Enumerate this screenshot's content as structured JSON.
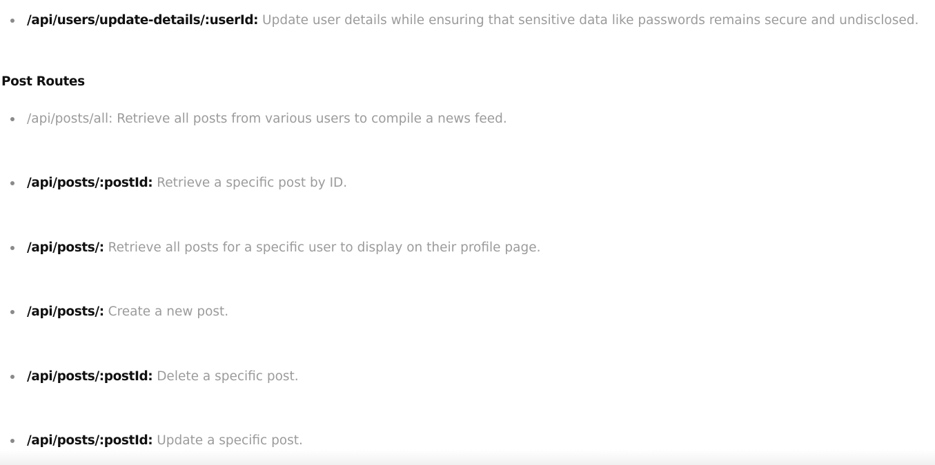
{
  "user_routes": {
    "items": [
      {
        "path": "/api/users/update-details/:userId:",
        "description": "Update user details while ensuring that sensitive data like passwords remains secure and undisclosed."
      }
    ]
  },
  "post_routes": {
    "heading": "Post Routes",
    "items": [
      {
        "path": "/api/posts/all:",
        "description": "Retrieve all posts from various users to compile a news feed."
      },
      {
        "path": "/api/posts/:postId:",
        "description": "Retrieve a specific post by ID."
      },
      {
        "path": "/api/posts/:",
        "description": "Retrieve all posts for a specific user to display on their profile page."
      },
      {
        "path": "/api/posts/:",
        "description": "Create a new post."
      },
      {
        "path": "/api/posts/:postId:",
        "description": "Delete a specific post."
      },
      {
        "path": "/api/posts/:postId:",
        "description": "Update a specific post."
      }
    ]
  }
}
